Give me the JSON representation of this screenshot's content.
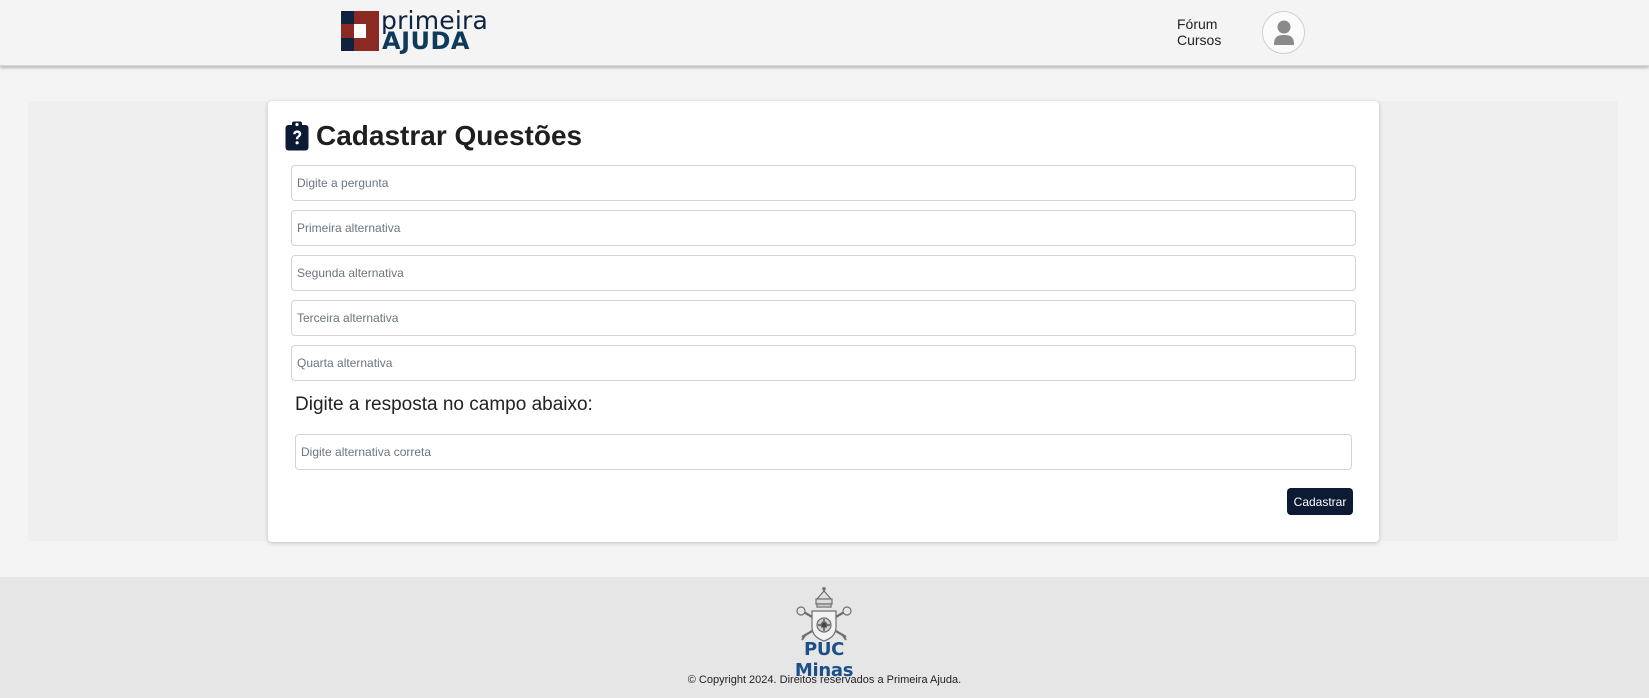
{
  "brand": {
    "logo_line1": "primeira",
    "logo_line2": "AJUDA",
    "colors": {
      "navy": "#0f2240",
      "red": "#8b2a22",
      "teal": "#0f3a5a"
    }
  },
  "nav": {
    "forum": "Fórum",
    "cursos": "Cursos",
    "avatar_icon": "user-icon"
  },
  "form": {
    "title": "Cadastrar Questões",
    "title_icon": "clipboard-question-icon",
    "question_placeholder": "Digite a pergunta",
    "alt1_placeholder": "Primeira alternativa",
    "alt2_placeholder": "Segunda alternativa",
    "alt3_placeholder": "Terceira alternativa",
    "alt4_placeholder": "Quarta alternativa",
    "answer_label": "Digite a resposta no campo abaixo:",
    "answer_placeholder": "Digite alternativa correta",
    "submit_label": "Cadastrar",
    "submit_color": "#0c1a33"
  },
  "footer": {
    "partner_logo_text": "PUC Minas",
    "copyright": "© Copyright 2024. Direitos reservados a Primeira Ajuda."
  }
}
